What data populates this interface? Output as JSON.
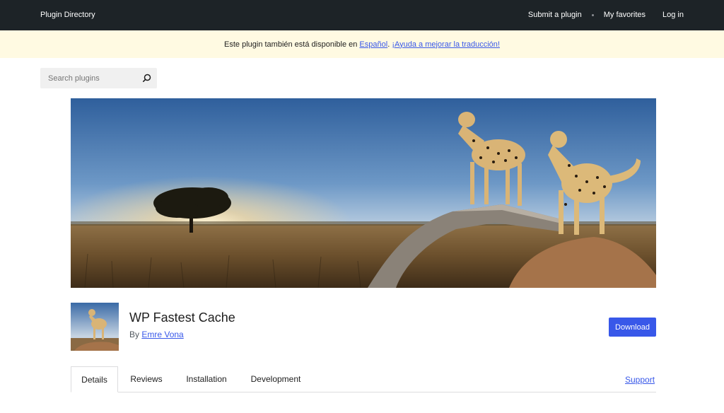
{
  "topbar": {
    "brand": "Plugin Directory",
    "nav": {
      "submit": "Submit a plugin",
      "favorites": "My favorites",
      "login": "Log in"
    }
  },
  "notice": {
    "text_before": "Este plugin también está disponible en ",
    "language_link": "Español",
    "text_mid": ". ",
    "help_link": "¡Ayuda a mejorar la traducción!"
  },
  "search": {
    "placeholder": "Search plugins",
    "icon": "search-icon"
  },
  "banner": {
    "image": "savanna-sunset-cheetahs-banner"
  },
  "plugin": {
    "thumbnail": "cheetah-plugin-icon",
    "name": "WP Fastest Cache",
    "by_label": "By",
    "author": "Emre Vona",
    "download_label": "Download"
  },
  "tabs": {
    "details": "Details",
    "reviews": "Reviews",
    "installation": "Installation",
    "development": "Development",
    "support": "Support"
  },
  "colors": {
    "topbar": "#1d2327",
    "notice": "#fffae2",
    "accent": "#3858e9"
  }
}
